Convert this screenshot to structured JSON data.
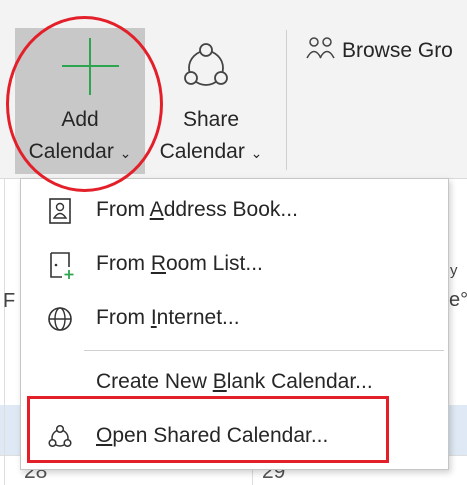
{
  "ribbon": {
    "add_calendar": {
      "line1": "Add",
      "line2": "Calendar",
      "chevron": "⌄"
    },
    "share_calendar": {
      "line1": "Share",
      "line2": "Calendar",
      "chevron": "⌄"
    },
    "browse_groups": "Browse Gro"
  },
  "menu": {
    "items": [
      {
        "pre": "From ",
        "acc": "A",
        "post": "ddress Book...",
        "icon": "address-book-icon"
      },
      {
        "pre": "From ",
        "acc": "R",
        "post": "oom List...",
        "icon": "room-list-icon"
      },
      {
        "pre": "From ",
        "acc": "I",
        "post": "nternet...",
        "icon": "globe-icon"
      },
      {
        "pre": "Create New ",
        "acc": "B",
        "post": "lank Calendar...",
        "icon": ""
      },
      {
        "pre": "",
        "acc": "O",
        "post": "pen Shared Calendar...",
        "icon": "shared-calendar-icon"
      }
    ]
  },
  "calendar": {
    "day_numbers": [
      "28",
      "29"
    ],
    "day_letters": [
      "F",
      "y",
      "e°"
    ]
  },
  "colors": {
    "highlight": "#e3202a",
    "plus_icon": "#2da44e",
    "selected_button": "#c8c8c8"
  }
}
